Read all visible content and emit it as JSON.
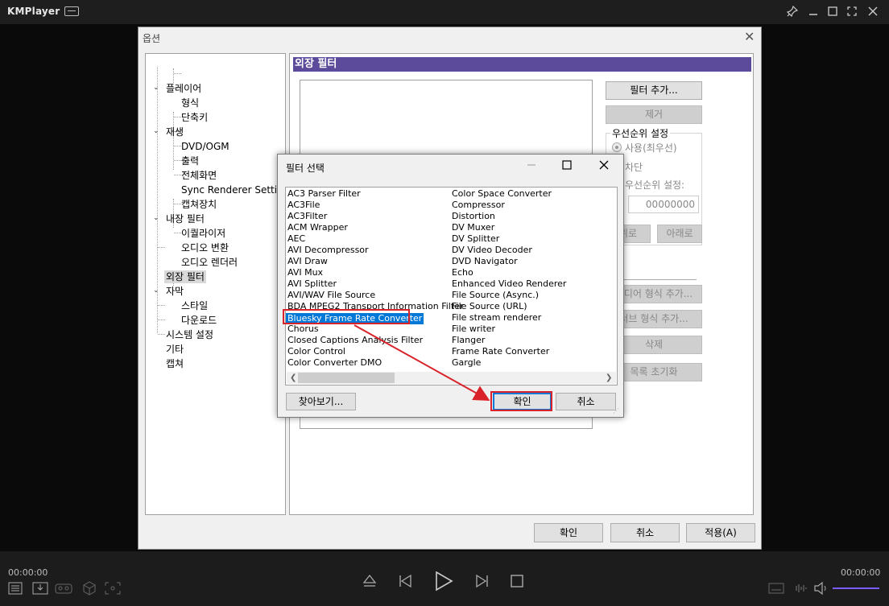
{
  "app": {
    "title": "KMPlayer",
    "time_left": "00:00:00",
    "time_right": "00:00:00"
  },
  "options_dialog": {
    "title": "옵션",
    "tree": [
      {
        "label": "플레이어",
        "level": 0,
        "expanded": true
      },
      {
        "label": "형식",
        "level": 1
      },
      {
        "label": "단축키",
        "level": 1
      },
      {
        "label": "재생",
        "level": 0,
        "expanded": true
      },
      {
        "label": "DVD/OGM",
        "level": 1
      },
      {
        "label": "출력",
        "level": 1
      },
      {
        "label": "전체화면",
        "level": 1
      },
      {
        "label": "Sync Renderer Settings",
        "level": 1
      },
      {
        "label": "캡쳐장치",
        "level": 1
      },
      {
        "label": "내장 필터",
        "level": 0,
        "expanded": true
      },
      {
        "label": "이퀄라이저",
        "level": 1
      },
      {
        "label": "오디오 변환",
        "level": 1
      },
      {
        "label": "오디오 렌더러",
        "level": 1
      },
      {
        "label": "외장 필터",
        "level": 0,
        "selected": true
      },
      {
        "label": "자막",
        "level": 0,
        "expanded": true
      },
      {
        "label": "스타일",
        "level": 1
      },
      {
        "label": "다운로드",
        "level": 1
      },
      {
        "label": "시스템 설정",
        "level": 0
      },
      {
        "label": "기타",
        "level": 0
      },
      {
        "label": "캡쳐",
        "level": 0
      }
    ],
    "panel_title": "외장 필터",
    "buttons": {
      "add_filter": "필터 추가...",
      "remove": "제거",
      "up": "위로",
      "down": "아래로",
      "add_media": "미디어 형식 추가...",
      "add_sub": "서브 형식 추가...",
      "delete": "삭제",
      "reset_list": "목록 초기화"
    },
    "priority": {
      "group_label": "우선순위 설정",
      "opt_use": "사용(최우선)",
      "opt_block": "차단",
      "opt_priority": "우선순위 설정:",
      "priority_value": "00000000"
    },
    "footer": {
      "ok": "확인",
      "cancel": "취소",
      "apply": "적용(A)"
    }
  },
  "filter_dialog": {
    "title": "필터 선택",
    "col1": [
      "AC3 Parser Filter",
      "AC3File",
      "AC3Filter",
      "ACM Wrapper",
      "AEC",
      "AVI Decompressor",
      "AVI Draw",
      "AVI Mux",
      "AVI Splitter",
      "AVI/WAV File Source",
      "BDA MPEG2 Transport Information Filter",
      "Bluesky Frame Rate Converter",
      "Chorus",
      "Closed Captions Analysis Filter",
      "Color Control",
      "Color Converter DMO"
    ],
    "col2": [
      "Color Space Converter",
      "Compressor",
      "Distortion",
      "DV Muxer",
      "DV Splitter",
      "DV Video Decoder",
      "DVD Navigator",
      "Echo",
      "Enhanced Video Renderer",
      "File Source (Async.)",
      "File Source (URL)",
      "File stream renderer",
      "File writer",
      "Flanger",
      "Frame Rate Converter",
      "Gargle"
    ],
    "selected": "Bluesky Frame Rate Converter",
    "browse": "찾아보기...",
    "ok": "확인",
    "cancel": "취소"
  },
  "colors": {
    "panel_header": "#5c4b9b",
    "selection": "#0078d7",
    "annotation": "#d9222a",
    "volume": "#7c5cff"
  }
}
